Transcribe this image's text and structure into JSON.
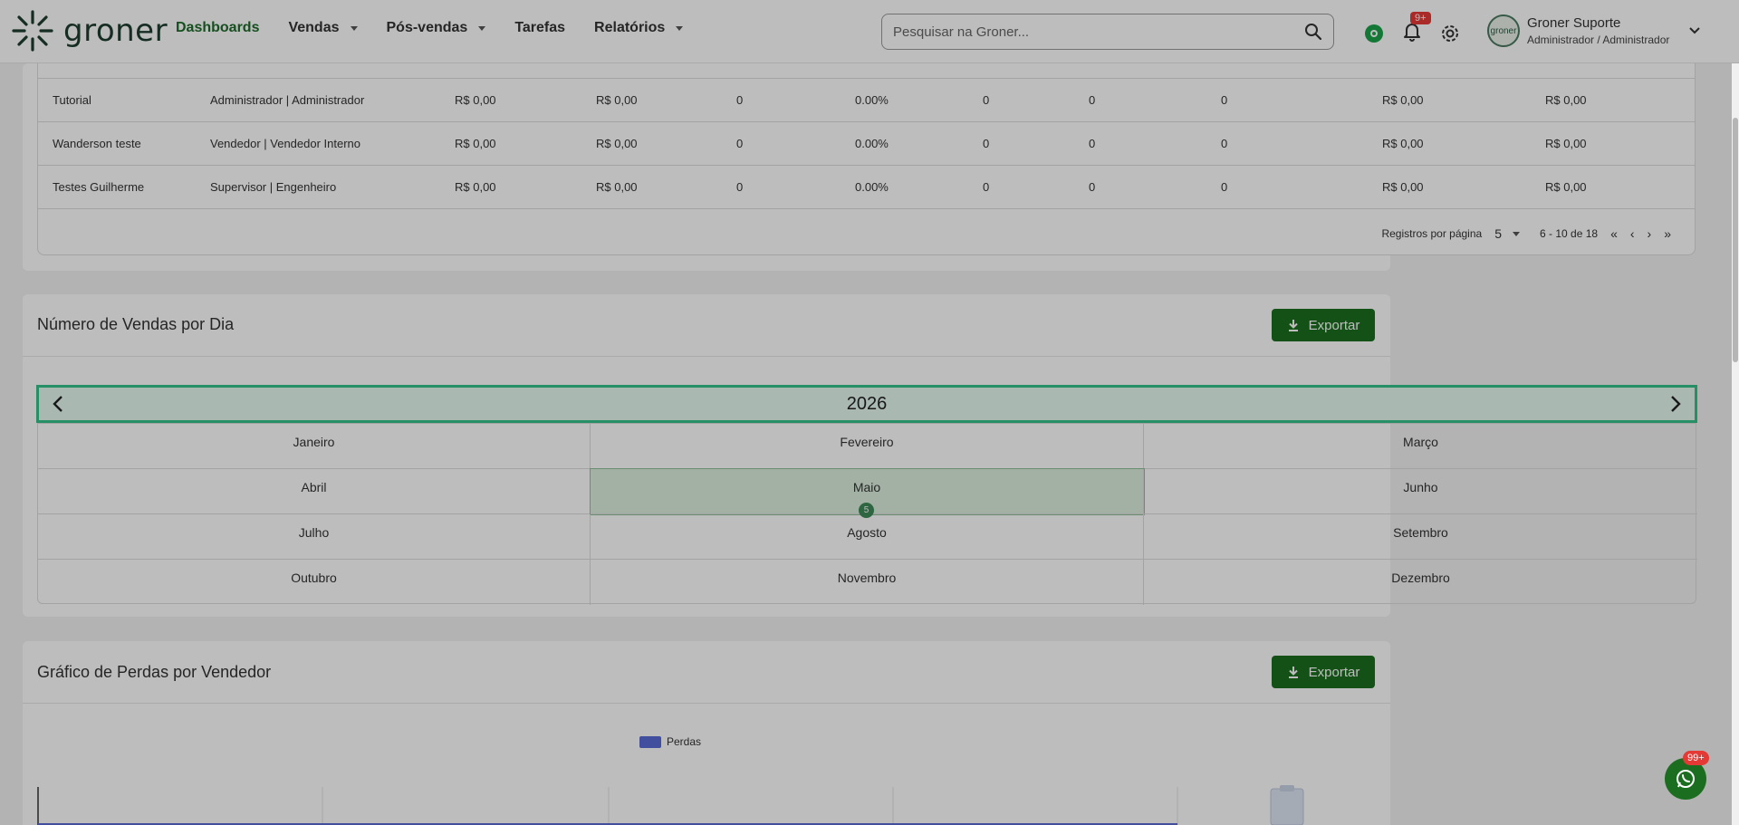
{
  "header": {
    "logo_text": "groner",
    "nav": [
      {
        "label": "Dashboards",
        "dropdown": false
      },
      {
        "label": "Vendas",
        "dropdown": true
      },
      {
        "label": "Pós-vendas",
        "dropdown": true
      },
      {
        "label": "Tarefas",
        "dropdown": false
      },
      {
        "label": "Relatórios",
        "dropdown": true
      }
    ],
    "search_placeholder": "Pesquisar na Groner...",
    "notification_badge": "9+",
    "user_name": "Groner Suporte",
    "user_role": "Administrador / Administrador",
    "avatar_text": "groner"
  },
  "table": {
    "rows": [
      [
        "Tutorial",
        "Administrador | Administrador",
        "R$ 0,00",
        "R$ 0,00",
        "0",
        "0.00%",
        "0",
        "0",
        "0",
        "R$ 0,00",
        "R$ 0,00"
      ],
      [
        "Wanderson teste",
        "Vendedor | Vendedor Interno",
        "R$ 0,00",
        "R$ 0,00",
        "0",
        "0.00%",
        "0",
        "0",
        "0",
        "R$ 0,00",
        "R$ 0,00"
      ],
      [
        "Testes Guilherme",
        "Supervisor | Engenheiro",
        "R$ 0,00",
        "R$ 0,00",
        "0",
        "0.00%",
        "0",
        "0",
        "0",
        "R$ 0,00",
        "R$ 0,00"
      ]
    ],
    "pager": {
      "label": "Registros por página",
      "per_page": "5",
      "range": "6 - 10 de 18"
    }
  },
  "vendas_dia": {
    "title": "Número de Vendas por Dia",
    "export_label": "Exportar",
    "year": "2026",
    "months": [
      "Janeiro",
      "Fevereiro",
      "Março",
      "Abril",
      "Maio",
      "Junho",
      "Julho",
      "Agosto",
      "Setembro",
      "Outubro",
      "Novembro",
      "Dezembro"
    ],
    "selected_month_index": 4,
    "selected_month_count": "5"
  },
  "perdas": {
    "title": "Gráfico de Perdas por Vendedor",
    "export_label": "Exportar",
    "legend": "Perdas",
    "legend_color": "#5a6bd6"
  },
  "whatsapp_badge": "99+",
  "colors": {
    "brand_green": "#1b6e1f",
    "accent_mint": "#35c28a"
  }
}
